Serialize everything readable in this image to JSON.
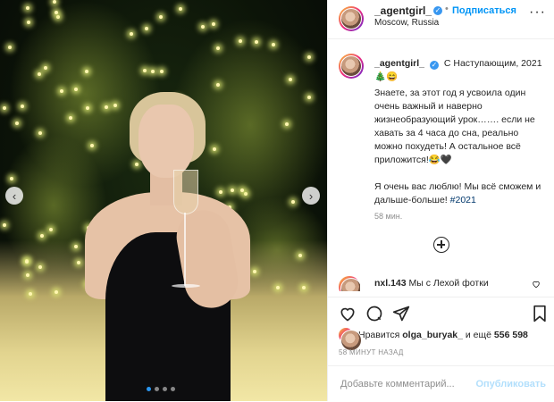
{
  "header": {
    "username": "_agentgirl_",
    "separator": "•",
    "follow_label": "Подписаться",
    "location": "Moscow, Russia",
    "more_label": "···"
  },
  "caption": {
    "username": "_agentgirl_",
    "title": "С Наступающим, 2021",
    "title_emoji": "🎄😄",
    "body1": "Знаете, за этот год я усвоила один очень важный и наверно жизнеобразующий урок……. если не хавать за 4 часа до сна, реально можно похудеть! А остальное всё приложится!😂🖤",
    "body2": "Я очень вас люблю! Мы всё сможем и дальше-больше! ",
    "hashtag": "#2021",
    "time": "58 мин."
  },
  "comment": {
    "username": "nxl.143",
    "text": "Мы с Лехой фотки"
  },
  "likes": {
    "prefix": "Нравится",
    "user": "olga_buryak_",
    "middle": "и ещё",
    "count": "556 598"
  },
  "timestamp": "58 МИНУТ НАЗАД",
  "add_comment": {
    "placeholder": "Добавьте комментарий...",
    "publish_label": "Опубликовать"
  },
  "carousel": {
    "prev_label": "‹",
    "next_label": "›",
    "total": 4,
    "active": 1
  },
  "colors": {
    "link_blue": "#0095f6",
    "publish_disabled": "#b2dffc",
    "hashtag": "#00376b",
    "verified": "#3897f0"
  }
}
